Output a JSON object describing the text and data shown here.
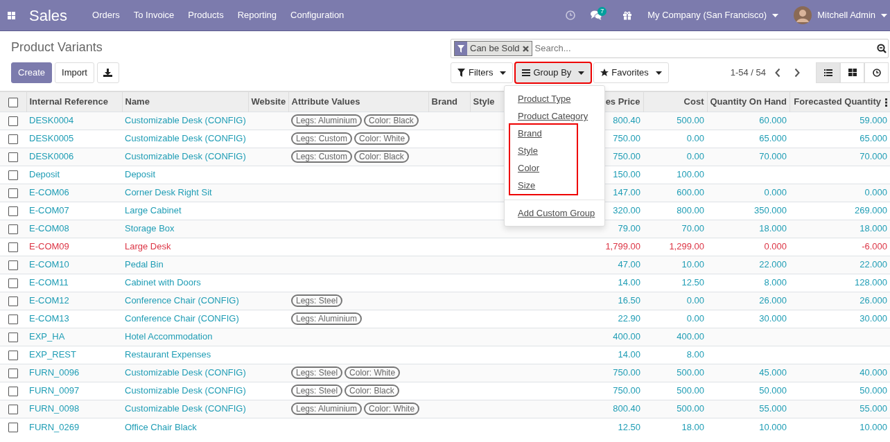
{
  "app": {
    "name": "Sales",
    "menu": [
      "Orders",
      "To Invoice",
      "Products",
      "Reporting",
      "Configuration"
    ]
  },
  "systray": {
    "messages_count": "7",
    "company": "My Company (San Francisco)",
    "user": "Mitchell Admin"
  },
  "breadcrumb": "Product Variants",
  "buttons": [
    {
      "label": "Create",
      "kind": "primary"
    },
    {
      "label": "Import",
      "kind": "secondary"
    }
  ],
  "search": {
    "facet": "Can be Sold",
    "placeholder": "Search..."
  },
  "search_buttons": [
    {
      "label": "Filters",
      "active": false,
      "highlighted": false
    },
    {
      "label": "Group By",
      "active": true,
      "highlighted": true
    },
    {
      "label": "Favorites",
      "active": false,
      "highlighted": false
    }
  ],
  "pager": "1-54 / 54",
  "views": [
    {
      "kind": "list",
      "selected": true
    },
    {
      "kind": "kanban",
      "selected": false
    },
    {
      "kind": "activity",
      "selected": false
    }
  ],
  "table": {
    "select_all_checked": false,
    "columns": [
      {
        "label": "Internal Reference",
        "kind": "text"
      },
      {
        "label": "Name",
        "kind": "text"
      },
      {
        "label": "Website",
        "kind": "text"
      },
      {
        "label": "Attribute Values",
        "kind": "tags"
      },
      {
        "label": "Brand",
        "kind": "text"
      },
      {
        "label": "Style",
        "kind": "text"
      },
      {
        "label": "es Price",
        "kind": "number"
      },
      {
        "label": "Cost",
        "kind": "number"
      },
      {
        "label": "Quantity On Hand",
        "kind": "number"
      },
      {
        "label": "Forecasted Quantity",
        "kind": "number"
      }
    ],
    "rows": [
      {
        "checked": false,
        "alert": false,
        "ref": "DESK0004",
        "name": "Customizable Desk (CONFIG)",
        "attributes": [
          "Legs: Aluminium",
          "Color: Black"
        ],
        "price": "800.40",
        "cost": "500.00",
        "on_hand": "60.000",
        "forecast": "59.000"
      },
      {
        "checked": false,
        "alert": false,
        "ref": "DESK0005",
        "name": "Customizable Desk (CONFIG)",
        "attributes": [
          "Legs: Custom",
          "Color: White"
        ],
        "price": "750.00",
        "cost": "0.00",
        "on_hand": "65.000",
        "forecast": "65.000"
      },
      {
        "checked": false,
        "alert": false,
        "ref": "DESK0006",
        "name": "Customizable Desk (CONFIG)",
        "attributes": [
          "Legs: Custom",
          "Color: Black"
        ],
        "price": "750.00",
        "cost": "0.00",
        "on_hand": "70.000",
        "forecast": "70.000"
      },
      {
        "checked": false,
        "alert": false,
        "ref": "Deposit",
        "name": "Deposit",
        "attributes": [],
        "price": "150.00",
        "cost": "100.00"
      },
      {
        "checked": false,
        "alert": false,
        "ref": "E-COM06",
        "name": "Corner Desk Right Sit",
        "attributes": [],
        "price": "147.00",
        "cost": "600.00",
        "on_hand": "0.000",
        "forecast": "0.000"
      },
      {
        "checked": false,
        "alert": false,
        "ref": "E-COM07",
        "name": "Large Cabinet",
        "attributes": [],
        "price": "320.00",
        "cost": "800.00",
        "on_hand": "350.000",
        "forecast": "269.000"
      },
      {
        "checked": false,
        "alert": false,
        "ref": "E-COM08",
        "name": "Storage Box",
        "attributes": [],
        "price": "79.00",
        "cost": "70.00",
        "on_hand": "18.000",
        "forecast": "18.000"
      },
      {
        "checked": false,
        "alert": true,
        "ref": "E-COM09",
        "name": "Large Desk",
        "attributes": [],
        "price": "1,799.00",
        "cost": "1,299.00",
        "on_hand": "0.000",
        "forecast": "-6.000"
      },
      {
        "checked": false,
        "alert": false,
        "ref": "E-COM10",
        "name": "Pedal Bin",
        "attributes": [],
        "price": "47.00",
        "cost": "10.00",
        "on_hand": "22.000",
        "forecast": "22.000"
      },
      {
        "checked": false,
        "alert": false,
        "ref": "E-COM11",
        "name": "Cabinet with Doors",
        "attributes": [],
        "price": "14.00",
        "cost": "12.50",
        "on_hand": "8.000",
        "forecast": "128.000"
      },
      {
        "checked": false,
        "alert": false,
        "ref": "E-COM12",
        "name": "Conference Chair (CONFIG)",
        "attributes": [
          "Legs: Steel"
        ],
        "price": "16.50",
        "cost": "0.00",
        "on_hand": "26.000",
        "forecast": "26.000"
      },
      {
        "checked": false,
        "alert": false,
        "ref": "E-COM13",
        "name": "Conference Chair (CONFIG)",
        "attributes": [
          "Legs: Aluminium"
        ],
        "price": "22.90",
        "cost": "0.00",
        "on_hand": "30.000",
        "forecast": "30.000"
      },
      {
        "checked": false,
        "alert": false,
        "ref": "EXP_HA",
        "name": "Hotel Accommodation",
        "attributes": [],
        "price": "400.00",
        "cost": "400.00"
      },
      {
        "checked": false,
        "alert": false,
        "ref": "EXP_REST",
        "name": "Restaurant Expenses",
        "attributes": [],
        "price": "14.00",
        "cost": "8.00"
      },
      {
        "checked": false,
        "alert": false,
        "ref": "FURN_0096",
        "name": "Customizable Desk (CONFIG)",
        "attributes": [
          "Legs: Steel",
          "Color: White"
        ],
        "price": "750.00",
        "cost": "500.00",
        "on_hand": "45.000",
        "forecast": "40.000"
      },
      {
        "checked": false,
        "alert": false,
        "ref": "FURN_0097",
        "name": "Customizable Desk (CONFIG)",
        "attributes": [
          "Legs: Steel",
          "Color: Black"
        ],
        "price": "750.00",
        "cost": "500.00",
        "on_hand": "50.000",
        "forecast": "50.000"
      },
      {
        "checked": false,
        "alert": false,
        "ref": "FURN_0098",
        "name": "Customizable Desk (CONFIG)",
        "attributes": [
          "Legs: Aluminium",
          "Color: White"
        ],
        "price": "800.40",
        "cost": "500.00",
        "on_hand": "55.000",
        "forecast": "55.000"
      },
      {
        "checked": false,
        "alert": false,
        "ref": "FURN_0269",
        "name": "Office Chair Black",
        "attributes": [],
        "price": "12.50",
        "cost": "18.00",
        "on_hand": "10.000",
        "forecast": "10.000"
      }
    ]
  },
  "group_by_menu": {
    "sections": [
      {
        "highlighted": false,
        "items": [
          "Product Type",
          "Product Category"
        ]
      },
      {
        "highlighted": true,
        "items": [
          "Brand",
          "Style",
          "Color",
          "Size"
        ]
      },
      {
        "highlighted": false,
        "divider": true,
        "items": [
          "Add Custom Group"
        ]
      }
    ]
  }
}
